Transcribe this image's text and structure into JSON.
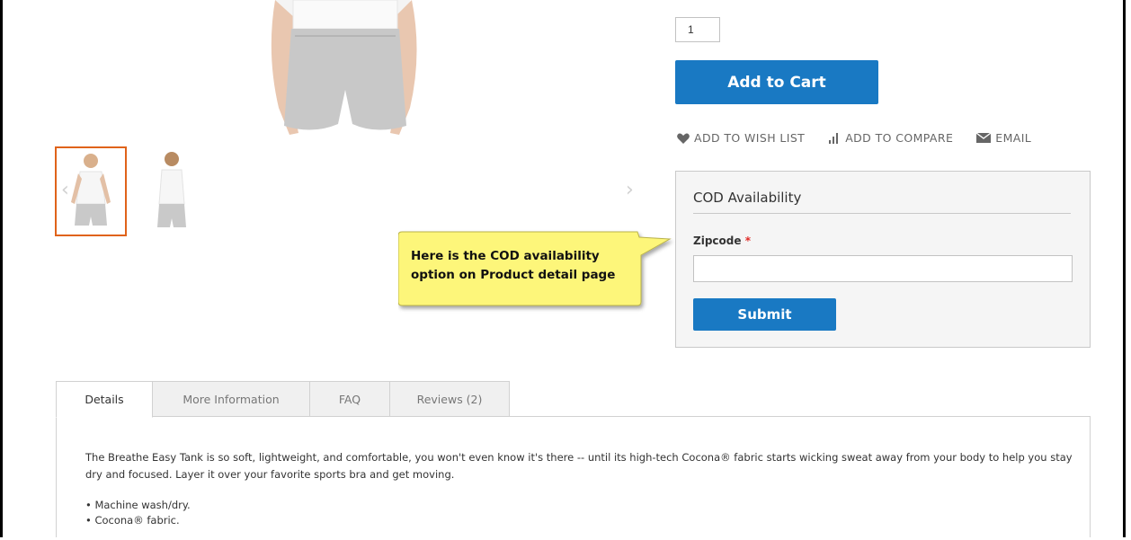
{
  "product": {
    "qty_value": "1",
    "add_to_cart_label": "Add to Cart",
    "actions": [
      {
        "label": "ADD TO WISH LIST",
        "icon": "heart-icon"
      },
      {
        "label": "ADD TO COMPARE",
        "icon": "compare-icon"
      },
      {
        "label": "EMAIL",
        "icon": "envelope-icon"
      }
    ]
  },
  "cod": {
    "title": "COD Availability",
    "zip_label": "Zipcode",
    "required_mark": "*",
    "submit_label": "Submit"
  },
  "callout": {
    "text": "Here is the COD availability option on Product detail page"
  },
  "tabs": [
    {
      "label": "Details",
      "active": true
    },
    {
      "label": "More Information",
      "active": false
    },
    {
      "label": "FAQ",
      "active": false
    },
    {
      "label": "Reviews (2)",
      "active": false
    }
  ],
  "details": {
    "description": "The Breathe Easy Tank is so soft, lightweight, and comfortable, you won't even know it's there -- until its high-tech Cocona® fabric starts wicking sweat away from your body to help you stay dry and focused. Layer it over your favorite sports bra and get moving.",
    "bullets": [
      "• Machine wash/dry.",
      "• Cocona® fabric."
    ]
  },
  "colors": {
    "primary": "#1979c3",
    "thumb_active_border": "#e0631a",
    "callout_fill": "#fdf67a",
    "required": "#e02b27"
  }
}
